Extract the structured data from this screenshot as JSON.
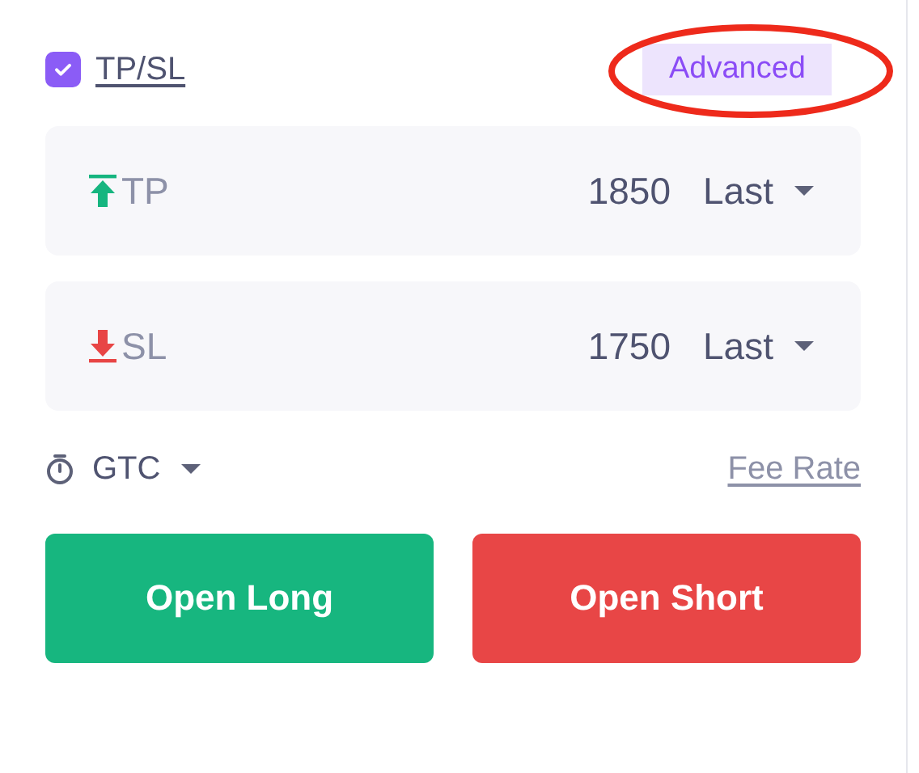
{
  "tpsl": {
    "label": "TP/SL",
    "checked": true
  },
  "advanced": {
    "label": "Advanced"
  },
  "orders": [
    {
      "kind": "tp",
      "label": "TP",
      "price": "1850",
      "trigger": "Last"
    },
    {
      "kind": "sl",
      "label": "SL",
      "price": "1750",
      "trigger": "Last"
    }
  ],
  "time_in_force": {
    "label": "GTC"
  },
  "fee_rate": {
    "label": "Fee Rate"
  },
  "buttons": [
    {
      "kind": "long",
      "label": "Open Long"
    },
    {
      "kind": "short",
      "label": "Open Short"
    }
  ]
}
